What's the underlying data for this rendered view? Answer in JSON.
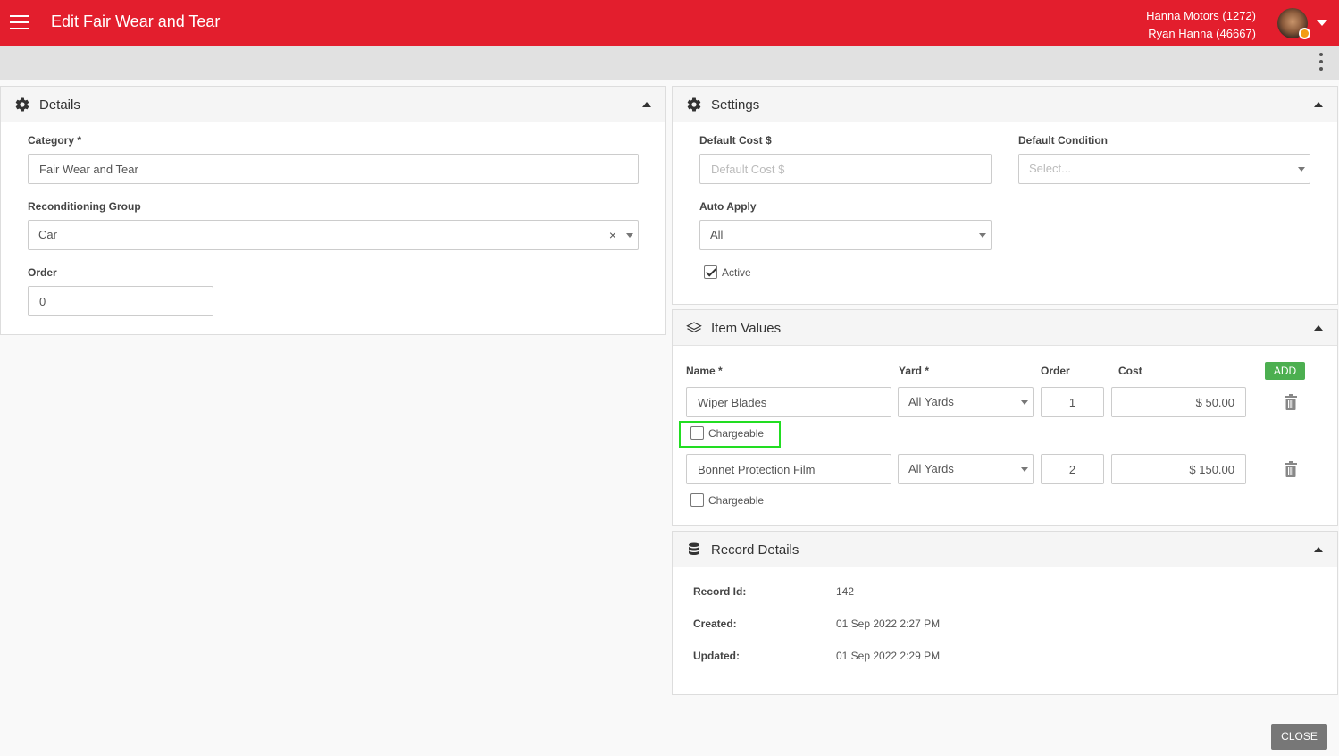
{
  "header": {
    "title": "Edit Fair Wear and Tear",
    "company": "Hanna Motors (1272)",
    "user": "Ryan Hanna (46667)",
    "brand_color": "#e31e2d"
  },
  "details": {
    "title": "Details",
    "category_label": "Category *",
    "category_value": "Fair Wear and Tear",
    "group_label": "Reconditioning Group",
    "group_value": "Car",
    "group_clear": "×",
    "order_label": "Order",
    "order_value": "0"
  },
  "settings": {
    "title": "Settings",
    "default_cost_label": "Default Cost $",
    "default_cost_placeholder": "Default Cost $",
    "default_condition_label": "Default Condition",
    "default_condition_placeholder": "Select...",
    "auto_apply_label": "Auto Apply",
    "auto_apply_value": "All",
    "active_label": "Active",
    "active_checked": true
  },
  "item_values": {
    "title": "Item Values",
    "headers": {
      "name": "Name *",
      "yard": "Yard *",
      "order": "Order",
      "cost": "Cost"
    },
    "add_label": "ADD",
    "add_color": "#4caf50",
    "items": [
      {
        "name": "Wiper Blades",
        "yard": "All Yards",
        "order": "1",
        "cost": "$ 50.00",
        "chargeable_label": "Chargeable",
        "chargeable": false
      },
      {
        "name": "Bonnet Protection Film",
        "yard": "All Yards",
        "order": "2",
        "cost": "$ 150.00",
        "chargeable_label": "Chargeable",
        "chargeable": false
      }
    ]
  },
  "record_details": {
    "title": "Record Details",
    "record_id_label": "Record Id:",
    "record_id": "142",
    "created_label": "Created:",
    "created": "01 Sep 2022 2:27 PM",
    "updated_label": "Updated:",
    "updated": "01 Sep 2022 2:29 PM"
  },
  "footer": {
    "close_label": "CLOSE"
  }
}
